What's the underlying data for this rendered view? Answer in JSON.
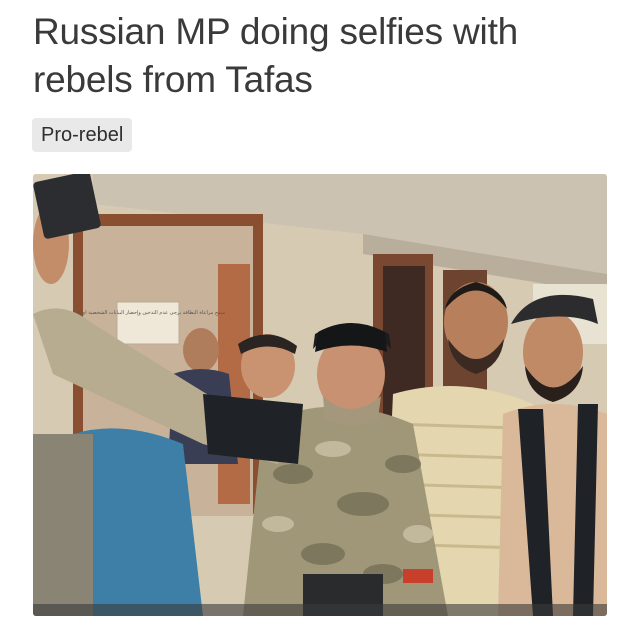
{
  "article": {
    "headline_line1": "Russian MP doing selfies with",
    "headline_line2": "rebels from Tafas",
    "tag_label": "Pro-rebel"
  },
  "photo": {
    "sign_text": "سمح مراعاة النظافة يرجى عدم التدخين وإحضار البيانات الشخصية اي قرار",
    "palette": {
      "wall": "#d9cdb6",
      "ceiling": "#cfc6b4",
      "door": "#9a5a3a",
      "camo": "#9c9378",
      "skin": "#c48d6a",
      "shirt_striped": "#e2d5ae",
      "shirt_blue": "#3d7fa6",
      "vest_black": "#1f2226"
    }
  }
}
